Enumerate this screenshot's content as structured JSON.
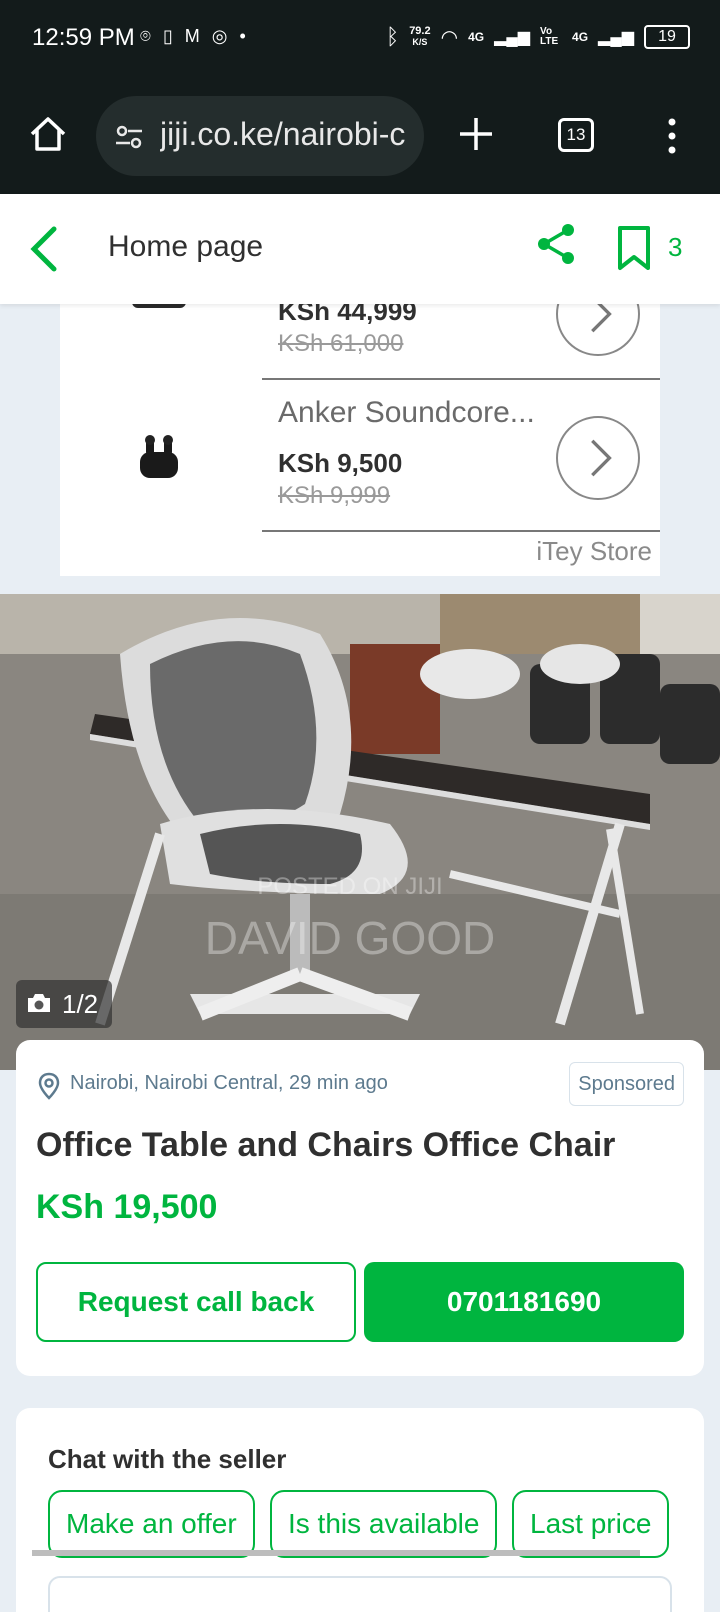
{
  "status_bar": {
    "time": "12:59 PM",
    "speed_value": "79.2",
    "speed_unit": "K/S",
    "network1": "4G",
    "volte": "Vo LTE",
    "network2": "4G",
    "battery": "19"
  },
  "browser": {
    "url": "jiji.co.ke/nairobi-c",
    "tab_count": "13"
  },
  "header": {
    "title": "Home page",
    "bookmark_count": "3"
  },
  "ad": {
    "item1": {
      "price": "KSh 44,999",
      "old_price": "KSh 61,000"
    },
    "item2": {
      "name": "Anker Soundcore...",
      "price": "KSh 9,500",
      "old_price": "KSh 9,999"
    },
    "store": "iTey Store"
  },
  "gallery": {
    "counter": "1/2",
    "watermark_line1": "POSTED ON JIJI",
    "watermark_line2": "DAVID GOOD"
  },
  "listing": {
    "location": "Nairobi, Nairobi Central, 29 min ago",
    "badge": "Sponsored",
    "title": "Office Table and Chairs Office Chair",
    "price": "KSh 19,500",
    "callback_label": "Request call back",
    "phone": "0701181690"
  },
  "chat": {
    "title": "Chat with the seller",
    "chips": [
      "Make an offer",
      "Is this available",
      "Last price"
    ]
  },
  "colors": {
    "brand_green": "#00b53f",
    "status_bar_bg": "#131b1b",
    "page_bg": "#e8eef4"
  }
}
